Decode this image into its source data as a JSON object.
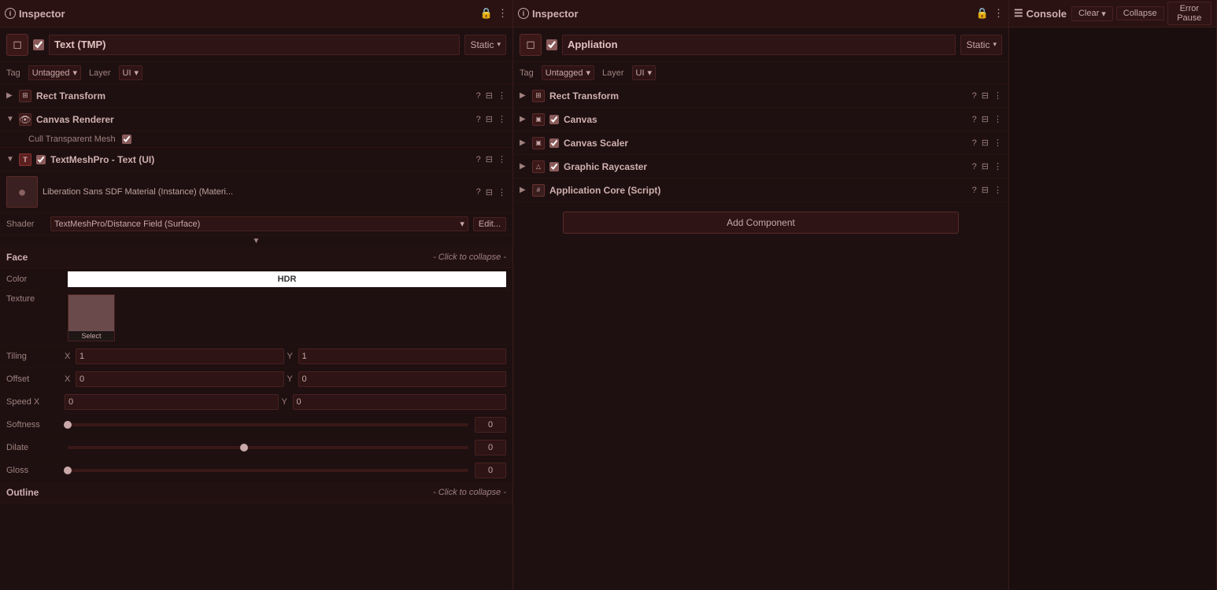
{
  "leftPanel": {
    "title": "Inspector",
    "object": {
      "name": "Text (TMP)",
      "static": "Static",
      "tag": "Untagged",
      "layer": "UI"
    },
    "components": [
      {
        "name": "Rect Transform",
        "icon": "rect",
        "expanded": false,
        "hasCheckbox": false,
        "hasEye": false
      },
      {
        "name": "Canvas Renderer",
        "icon": "eye",
        "expanded": true,
        "hasCheckbox": false,
        "hasEye": true,
        "children": [
          {
            "label": "Cull Transparent Mesh",
            "value": "checked"
          }
        ]
      },
      {
        "name": "TextMeshPro - Text (UI)",
        "icon": "T",
        "expanded": true,
        "hasCheckbox": true
      }
    ],
    "material": {
      "name": "Liberation Sans SDF Material (Instance) (Materi...",
      "shader": "TextMeshPro/Distance Field (Surface)"
    },
    "face": {
      "sectionTitle": "Face",
      "collapseText": "- Click to collapse -",
      "color": {
        "label": "Color",
        "hdr": "HDR"
      },
      "texture": {
        "label": "Texture",
        "selectLabel": "Select"
      },
      "tiling": {
        "label": "Tiling",
        "x": "1",
        "y": "1"
      },
      "offset": {
        "label": "Offset",
        "x": "0",
        "y": "0"
      },
      "speed": {
        "label": "Speed X",
        "x": "0",
        "y": "0"
      },
      "softness": {
        "label": "Softness",
        "value": "0",
        "thumbPos": "0%"
      },
      "dilate": {
        "label": "Dilate",
        "value": "0",
        "thumbPos": "44%"
      },
      "gloss": {
        "label": "Gloss",
        "value": "0",
        "thumbPos": "0%"
      }
    },
    "outline": {
      "sectionTitle": "Outline",
      "collapseText": "- Click to collapse -"
    }
  },
  "middlePanel": {
    "title": "Inspector",
    "object": {
      "name": "Appliation",
      "static": "Static",
      "tag": "Untagged",
      "layer": "UI"
    },
    "components": [
      {
        "name": "Rect Transform",
        "icon": "rect",
        "expanded": false,
        "hasCheckbox": false
      },
      {
        "name": "Canvas",
        "icon": "canvas",
        "expanded": false,
        "hasCheckbox": true
      },
      {
        "name": "Canvas Scaler",
        "icon": "canvas-scaler",
        "expanded": false,
        "hasCheckbox": true
      },
      {
        "name": "Graphic Raycaster",
        "icon": "raycaster",
        "expanded": false,
        "hasCheckbox": true
      },
      {
        "name": "Application Core (Script)",
        "icon": "script",
        "expanded": false,
        "hasCheckbox": false
      }
    ],
    "addComponent": "Add Component"
  },
  "rightPanel": {
    "title": "Console",
    "buttons": {
      "clear": "Clear",
      "clearDropdown": "▾",
      "collapse": "Collapse",
      "errorPause": "Error Pause"
    }
  }
}
